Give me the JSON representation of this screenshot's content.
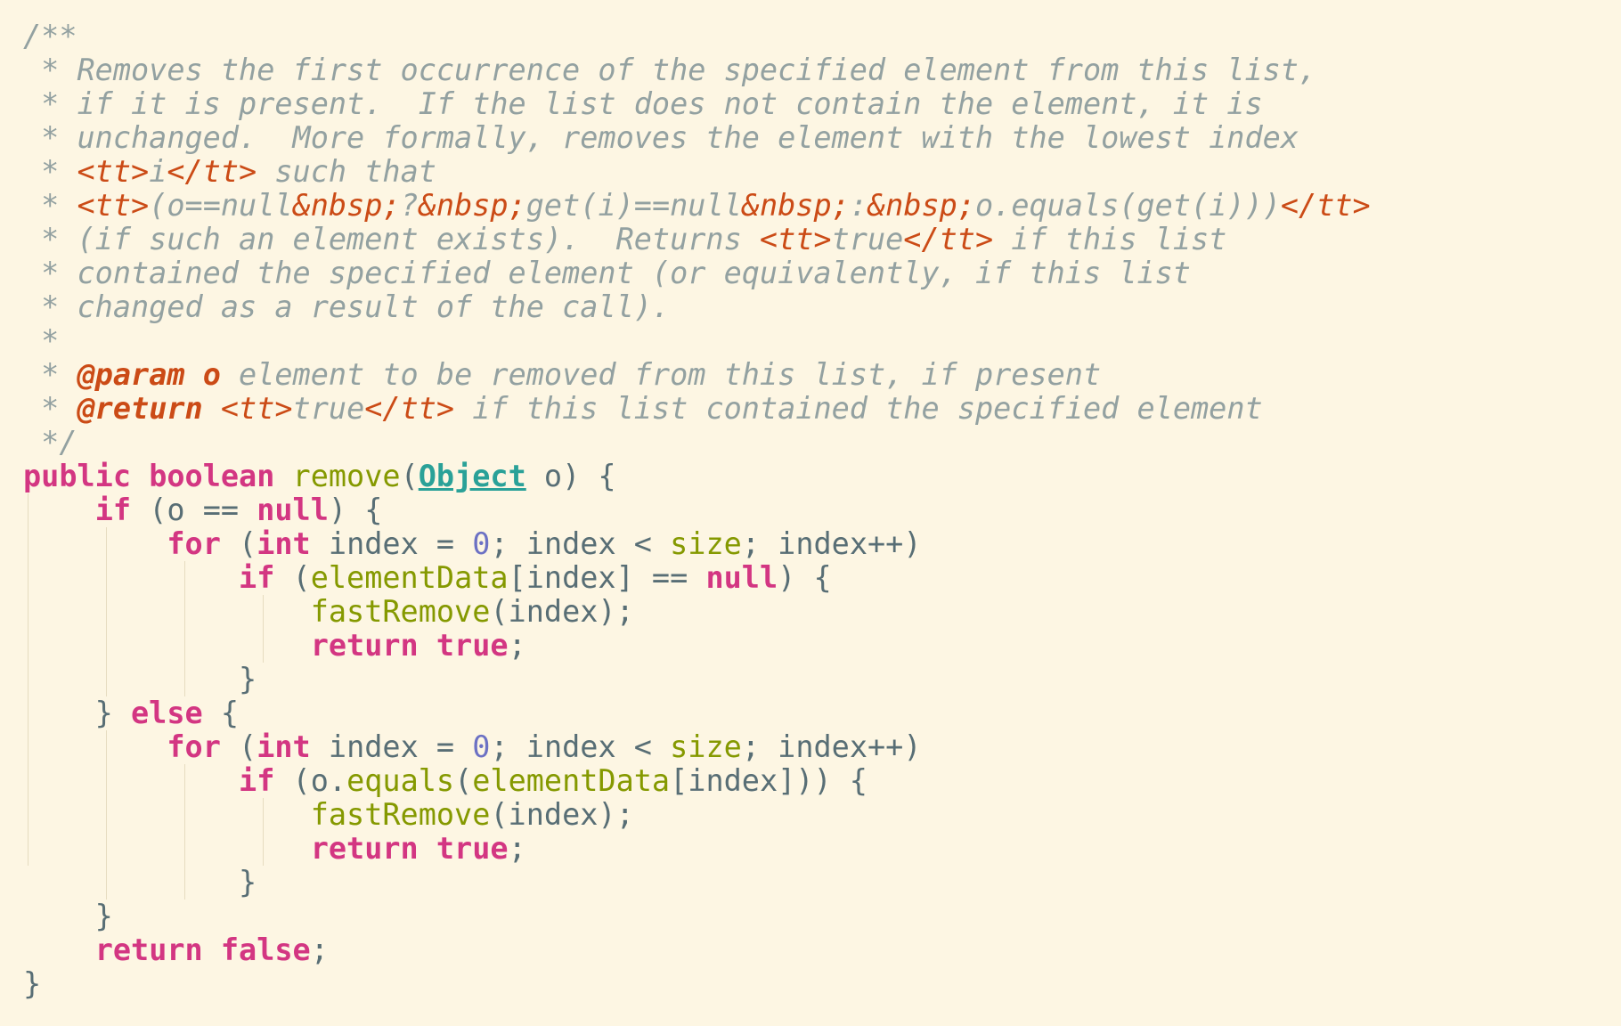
{
  "editor": {
    "theme": {
      "background": "#fdf6e3",
      "comment": "#93a1a1",
      "doc_tag": "#cb4b16",
      "keyword": "#d33682",
      "method": "#859900",
      "type": "#2aa198",
      "number": "#6c71c4",
      "text": "#586e75"
    },
    "lines": [
      [
        {
          "c": "comment",
          "t": "/**"
        }
      ],
      [
        {
          "c": "comment",
          "t": " * Removes the first occurrence of the specified element from this list,"
        }
      ],
      [
        {
          "c": "comment",
          "t": " * if it is present.  If the list does not contain the element, it is"
        }
      ],
      [
        {
          "c": "comment",
          "t": " * unchanged.  More formally, removes the element with the lowest index"
        }
      ],
      [
        {
          "c": "comment",
          "t": " * "
        },
        {
          "c": "tag",
          "t": "<tt>"
        },
        {
          "c": "comment",
          "t": "i"
        },
        {
          "c": "tag",
          "t": "</tt>"
        },
        {
          "c": "comment",
          "t": " such that"
        }
      ],
      [
        {
          "c": "comment",
          "t": " * "
        },
        {
          "c": "tag",
          "t": "<tt>"
        },
        {
          "c": "comment",
          "t": "(o==null"
        },
        {
          "c": "tag",
          "t": "&nbsp;"
        },
        {
          "c": "comment",
          "t": "?"
        },
        {
          "c": "tag",
          "t": "&nbsp;"
        },
        {
          "c": "comment",
          "t": "get(i)==null"
        },
        {
          "c": "tag",
          "t": "&nbsp;"
        },
        {
          "c": "comment",
          "t": ":"
        },
        {
          "c": "tag",
          "t": "&nbsp;"
        },
        {
          "c": "comment",
          "t": "o.equals(get(i)))"
        },
        {
          "c": "tag",
          "t": "</tt>"
        }
      ],
      [
        {
          "c": "comment",
          "t": " * (if such an element exists).  Returns "
        },
        {
          "c": "tag",
          "t": "<tt>"
        },
        {
          "c": "comment",
          "t": "true"
        },
        {
          "c": "tag",
          "t": "</tt>"
        },
        {
          "c": "comment",
          "t": " if this list"
        }
      ],
      [
        {
          "c": "comment",
          "t": " * contained the specified element (or equivalently, if this list"
        }
      ],
      [
        {
          "c": "comment",
          "t": " * changed as a result of the call)."
        }
      ],
      [
        {
          "c": "comment",
          "t": " *"
        }
      ],
      [
        {
          "c": "comment",
          "t": " * "
        },
        {
          "c": "doctag",
          "t": "@param"
        },
        {
          "c": "comment",
          "t": " "
        },
        {
          "c": "doctag",
          "t": "o"
        },
        {
          "c": "comment",
          "t": " element to be removed from this list, if present"
        }
      ],
      [
        {
          "c": "comment",
          "t": " * "
        },
        {
          "c": "doctag",
          "t": "@return"
        },
        {
          "c": "comment",
          "t": " "
        },
        {
          "c": "tag",
          "t": "<tt>"
        },
        {
          "c": "comment",
          "t": "true"
        },
        {
          "c": "tag",
          "t": "</tt>"
        },
        {
          "c": "comment",
          "t": " if this list contained the specified element"
        }
      ],
      [
        {
          "c": "comment",
          "t": " */"
        }
      ],
      [
        {
          "c": "kw",
          "t": "public"
        },
        {
          "c": "plain",
          "t": " "
        },
        {
          "c": "kw",
          "t": "boolean"
        },
        {
          "c": "plain",
          "t": " "
        },
        {
          "c": "method",
          "t": "remove"
        },
        {
          "c": "plain",
          "t": "("
        },
        {
          "c": "type",
          "t": "Object"
        },
        {
          "c": "plain",
          "t": " o) {"
        }
      ],
      [
        {
          "c": "plain",
          "t": "    "
        },
        {
          "c": "kw",
          "t": "if"
        },
        {
          "c": "plain",
          "t": " (o == "
        },
        {
          "c": "kw",
          "t": "null"
        },
        {
          "c": "plain",
          "t": ") {"
        }
      ],
      [
        {
          "c": "plain",
          "t": "        "
        },
        {
          "c": "kw",
          "t": "for"
        },
        {
          "c": "plain",
          "t": " ("
        },
        {
          "c": "kw",
          "t": "int"
        },
        {
          "c": "plain",
          "t": " index = "
        },
        {
          "c": "num",
          "t": "0"
        },
        {
          "c": "plain",
          "t": "; index < "
        },
        {
          "c": "field",
          "t": "size"
        },
        {
          "c": "plain",
          "t": "; index++)"
        }
      ],
      [
        {
          "c": "plain",
          "t": "            "
        },
        {
          "c": "kw",
          "t": "if"
        },
        {
          "c": "plain",
          "t": " ("
        },
        {
          "c": "field",
          "t": "elementData"
        },
        {
          "c": "plain",
          "t": "[index] == "
        },
        {
          "c": "kw",
          "t": "null"
        },
        {
          "c": "plain",
          "t": ") {"
        }
      ],
      [
        {
          "c": "plain",
          "t": "                "
        },
        {
          "c": "method",
          "t": "fastRemove"
        },
        {
          "c": "plain",
          "t": "(index);"
        }
      ],
      [
        {
          "c": "plain",
          "t": "                "
        },
        {
          "c": "kw",
          "t": "return"
        },
        {
          "c": "plain",
          "t": " "
        },
        {
          "c": "kw",
          "t": "true"
        },
        {
          "c": "plain",
          "t": ";"
        }
      ],
      [
        {
          "c": "plain",
          "t": "            }"
        }
      ],
      [
        {
          "c": "plain",
          "t": "    } "
        },
        {
          "c": "kw",
          "t": "else"
        },
        {
          "c": "plain",
          "t": " {"
        }
      ],
      [
        {
          "c": "plain",
          "t": "        "
        },
        {
          "c": "kw",
          "t": "for"
        },
        {
          "c": "plain",
          "t": " ("
        },
        {
          "c": "kw",
          "t": "int"
        },
        {
          "c": "plain",
          "t": " index = "
        },
        {
          "c": "num",
          "t": "0"
        },
        {
          "c": "plain",
          "t": "; index < "
        },
        {
          "c": "field",
          "t": "size"
        },
        {
          "c": "plain",
          "t": "; index++)"
        }
      ],
      [
        {
          "c": "plain",
          "t": "            "
        },
        {
          "c": "kw",
          "t": "if"
        },
        {
          "c": "plain",
          "t": " (o."
        },
        {
          "c": "method",
          "t": "equals"
        },
        {
          "c": "plain",
          "t": "("
        },
        {
          "c": "field",
          "t": "elementData"
        },
        {
          "c": "plain",
          "t": "[index])) {"
        }
      ],
      [
        {
          "c": "plain",
          "t": "                "
        },
        {
          "c": "method",
          "t": "fastRemove"
        },
        {
          "c": "plain",
          "t": "(index);"
        }
      ],
      [
        {
          "c": "plain",
          "t": "                "
        },
        {
          "c": "kw",
          "t": "return"
        },
        {
          "c": "plain",
          "t": " "
        },
        {
          "c": "kw",
          "t": "true"
        },
        {
          "c": "plain",
          "t": ";"
        }
      ],
      [
        {
          "c": "plain",
          "t": "            }"
        }
      ],
      [
        {
          "c": "plain",
          "t": "    }"
        }
      ],
      [
        {
          "c": "plain",
          "t": "    "
        },
        {
          "c": "kw",
          "t": "return"
        },
        {
          "c": "plain",
          "t": " "
        },
        {
          "c": "kw",
          "t": "false"
        },
        {
          "c": "plain",
          "t": ";"
        }
      ],
      [
        {
          "c": "plain",
          "t": "}"
        }
      ]
    ]
  }
}
